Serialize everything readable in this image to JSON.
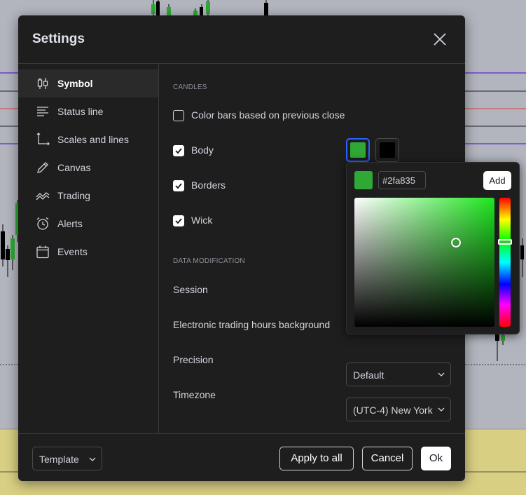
{
  "dialog": {
    "title": "Settings",
    "close_icon": "close-icon"
  },
  "sidebar": {
    "items": [
      {
        "label": "Symbol",
        "icon": "candlestick-icon",
        "active": true
      },
      {
        "label": "Status line",
        "icon": "status-line-icon",
        "active": false
      },
      {
        "label": "Scales and lines",
        "icon": "scales-icon",
        "active": false
      },
      {
        "label": "Canvas",
        "icon": "pencil-icon",
        "active": false
      },
      {
        "label": "Trading",
        "icon": "trading-icon",
        "active": false
      },
      {
        "label": "Alerts",
        "icon": "alarm-clock-icon",
        "active": false
      },
      {
        "label": "Events",
        "icon": "calendar-icon",
        "active": false
      }
    ]
  },
  "candles": {
    "section_title": "CANDLES",
    "color_bars": {
      "label": "Color bars based on previous close",
      "checked": false
    },
    "body": {
      "label": "Body",
      "checked": true,
      "up_color": "#2fa835",
      "down_color": "#000000"
    },
    "borders": {
      "label": "Borders",
      "checked": true
    },
    "wick": {
      "label": "Wick",
      "checked": true
    }
  },
  "data_modification": {
    "section_title": "DATA MODIFICATION",
    "session_label": "Session",
    "eth_label": "Electronic trading hours background",
    "precision_label": "Precision",
    "precision_value": "Default",
    "timezone_label": "Timezone",
    "timezone_value": "(UTC-4) New York"
  },
  "color_picker": {
    "hex_value": "#2fa835",
    "add_label": "Add",
    "current_color": "#2fa835"
  },
  "footer": {
    "template_label": "Template",
    "apply_all_label": "Apply to all",
    "cancel_label": "Cancel",
    "ok_label": "Ok"
  },
  "colors": {
    "accent_focus": "#2962ff",
    "dialog_bg": "#1e1e1e",
    "chart_bg": "#b2b5be",
    "volume_area": "#d9cf83",
    "line_purple": "#6a3fd1",
    "line_red": "#e04040"
  }
}
